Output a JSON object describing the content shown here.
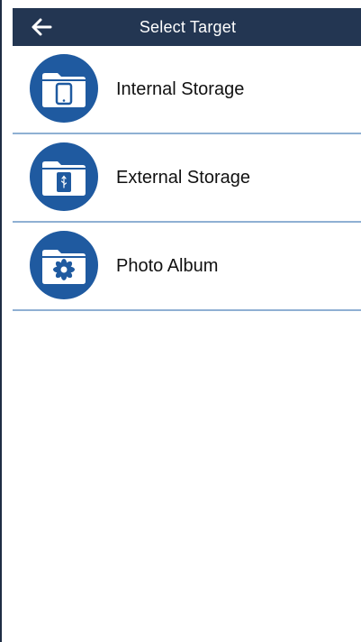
{
  "header": {
    "title": "Select Target",
    "back_icon": "back-arrow-icon"
  },
  "colors": {
    "header_bg": "#233652",
    "accent": "#1f5aa0",
    "divider": "#8fb0d3"
  },
  "list": {
    "items": [
      {
        "label": "Internal Storage",
        "icon": "phone-folder-icon"
      },
      {
        "label": "External Storage",
        "icon": "usb-folder-icon"
      },
      {
        "label": "Photo Album",
        "icon": "photo-folder-icon"
      }
    ]
  }
}
